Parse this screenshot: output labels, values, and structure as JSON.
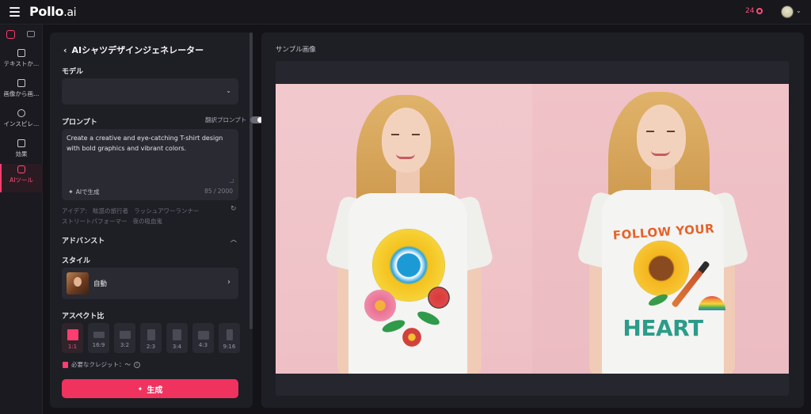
{
  "app": {
    "logo": "Pollo",
    "logo_suffix": ".ai",
    "credits": "24"
  },
  "rail": {
    "items": [
      {
        "label": "テキストか…",
        "icon": "text-image-icon"
      },
      {
        "label": "画像から画…",
        "icon": "image-to-image-icon"
      },
      {
        "label": "インスピレ…",
        "icon": "compass-icon"
      },
      {
        "label": "効果",
        "icon": "effects-icon"
      },
      {
        "label": "AIツール",
        "icon": "ai-tools-icon"
      }
    ]
  },
  "form": {
    "title": "AIシャツデザインジェネレーター",
    "model_label": "モデル",
    "model_value": "",
    "prompt_label": "プロンプト",
    "translate_label": "翻訳プロンプト",
    "prompt_text": "Create a creative and eye-catching T-shirt design with bold graphics and vibrant colors.",
    "ai_generate": "AIで生成",
    "char_count": "85 / 2000",
    "ideas_prefix": "アイデア:",
    "ideas": [
      "眩惑の旅行者",
      "ラッシュアワーランナー",
      "ストリートパフォーマー",
      "夜の吸血鬼"
    ],
    "advanced_label": "アドバンスト",
    "style_label": "スタイル",
    "style_value": "自動",
    "aspect_label": "アスペクト比",
    "aspect_ratios": [
      "1:1",
      "16:9",
      "3:2",
      "2:3",
      "3:4",
      "4:3",
      "9:16"
    ],
    "aspect_selected": "1:1",
    "credits_needed": "必要なクレジット：～",
    "generate_button": "生成"
  },
  "sample": {
    "title": "サンプル画像",
    "shirt_text_top": "FOLLOW YOUR",
    "shirt_text_bottom": "HEART"
  },
  "colors": {
    "accent": "#f0325f",
    "background": "#131318",
    "panel": "#1e1e25"
  }
}
